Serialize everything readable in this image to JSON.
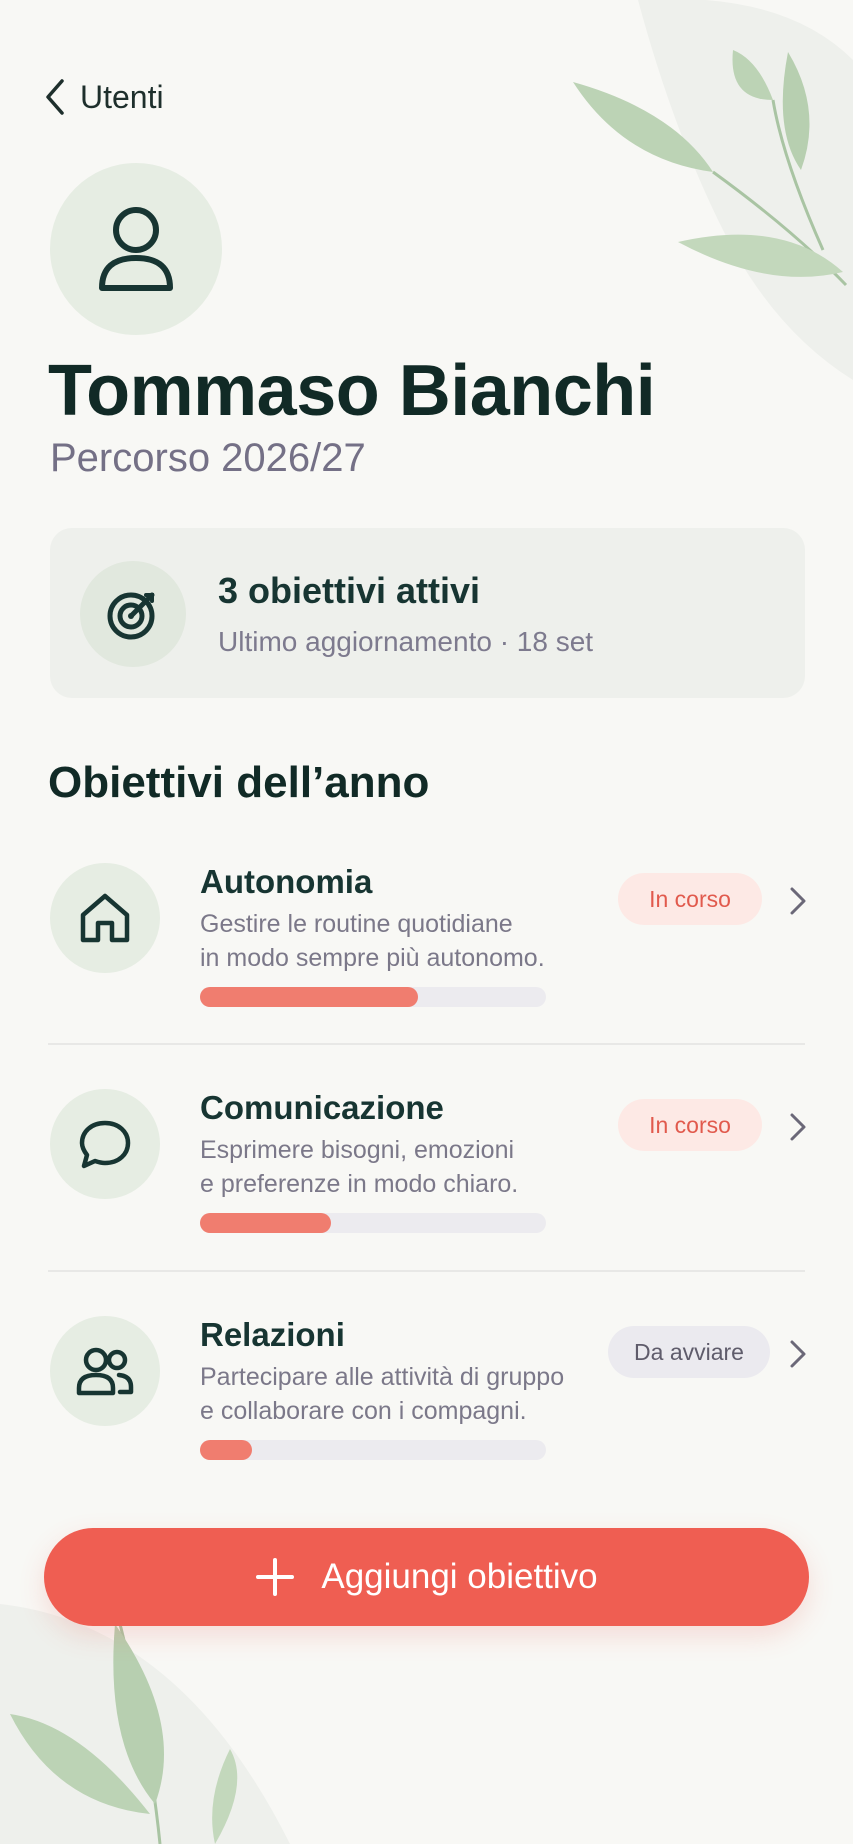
{
  "nav": {
    "back_label": "Utenti"
  },
  "profile": {
    "name": "Tommaso Bianchi",
    "subtitle": "Percorso 2026/27"
  },
  "summary": {
    "title": "3 obiettivi attivi",
    "subtitle": "Ultimo aggiornamento · 18 set",
    "icon": "target-icon"
  },
  "section": {
    "title": "Obiettivi dell’anno"
  },
  "goals": [
    {
      "title": "Autonomia",
      "description_line1": "Gestire le routine quotidiane",
      "description_line2": "in modo sempre più autonomo.",
      "status": "In corso",
      "progress": 0.63,
      "icon": "home-icon"
    },
    {
      "title": "Comunicazione",
      "description_line1": "Esprimere bisogni, emozioni",
      "description_line2": "e preferenze in modo chiaro.",
      "status": "In corso",
      "progress": 0.38,
      "icon": "chat-bubble-icon"
    },
    {
      "title": "Relazioni",
      "description_line1": "Partecipare alle attività di gruppo",
      "description_line2": "e collaborare con i compagni.",
      "status": "Da avviare",
      "progress": 0.15,
      "icon": "users-icon"
    }
  ],
  "actions": {
    "add_goal_label": "Aggiungi obiettivo"
  },
  "colors": {
    "accent": "#ef5e52",
    "progress": "#f07d6f",
    "dark_text": "#112a26",
    "muted_text": "#7b7889",
    "icon_circle": "#e6ede3"
  }
}
